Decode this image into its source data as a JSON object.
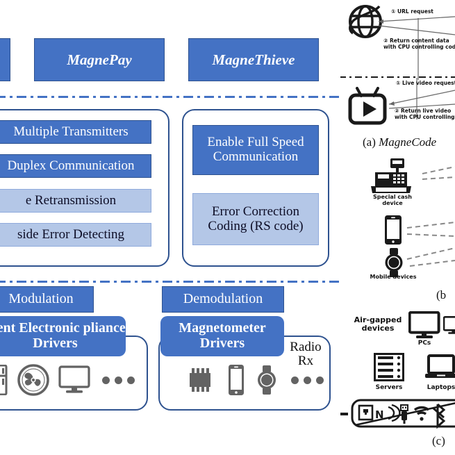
{
  "left_panel": {
    "title_boxes": [
      {
        "label": "",
        "partial": true
      },
      {
        "label": "MagnePay",
        "partial": false
      },
      {
        "label": "MagneThieve",
        "partial": false
      }
    ],
    "feature_group_left": {
      "items": [
        {
          "label": "Multiple Transmitters",
          "tone": "dark"
        },
        {
          "label": "Duplex Communication",
          "tone": "dark"
        },
        {
          "label": "e Retransmission",
          "tone": "light"
        },
        {
          "label": "side Error Detecting",
          "tone": "light"
        }
      ]
    },
    "feature_group_right": {
      "items": [
        {
          "label": "Enable Full Speed Communication",
          "tone": "dark"
        },
        {
          "label": "Error Correction Coding (RS code)",
          "tone": "light"
        }
      ]
    },
    "driver_group_left": {
      "title": "Modulation",
      "driver_label": "erent Electronic pliance Drivers",
      "icons": [
        "fridge-icon",
        "fan-icon",
        "monitor-icon",
        "ellipsis-icon"
      ]
    },
    "driver_group_right": {
      "title": "Demodulation",
      "driver_label": "Magnetometer Drivers",
      "radio_label": "Radio Rx",
      "icons": [
        "chip-icon",
        "smartphone-icon",
        "smartwatch-icon",
        "ellipsis-icon"
      ]
    }
  },
  "right_panel": {
    "section_a": {
      "caption_prefix": "(a)",
      "caption_name": "MagneCode",
      "globe_icon": "globe-icon",
      "tv_icon": "tv-play-icon",
      "arrows": [
        {
          "num": "①",
          "text": "URL request"
        },
        {
          "num": "②",
          "text": "Return content data",
          "text2": "with CPU controlling cod"
        },
        {
          "num": "①",
          "text": "Live video request"
        },
        {
          "num": "②",
          "text": "Return live video",
          "text2": "with CPU controlling"
        }
      ]
    },
    "section_b": {
      "caption": "(b",
      "cash_label": "Special cash device",
      "mobile_label": "Mobile devices",
      "icons": [
        "cash-register-icon",
        "smartphone-icon",
        "smartwatch-icon"
      ]
    },
    "section_c": {
      "caption": "(c)",
      "airgap_label": "Air-gapped devices",
      "pcs_label": "PCs",
      "servers_label": "Servers",
      "laptops_label": "Laptops",
      "banned_icons": [
        "ethernet-icon",
        "nfc-icon",
        "usb-icon",
        "wifi-icon",
        "bluetooth-icon"
      ]
    }
  },
  "colors": {
    "accent_blue": "#4472C4",
    "light_blue": "#B4C7E7",
    "border_blue": "#2E528F",
    "icon_gray": "#636363",
    "ink": "#1a1a1a"
  }
}
